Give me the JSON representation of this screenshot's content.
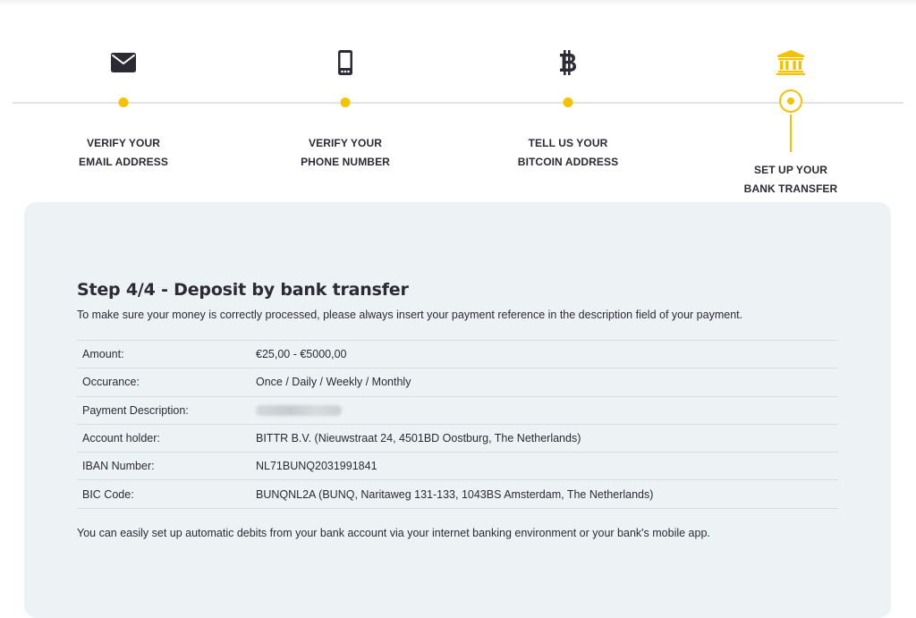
{
  "stepper": {
    "accent_color": "#f5c200",
    "steps": [
      {
        "icon": "envelope-icon",
        "line1": "VERIFY YOUR",
        "line2": "EMAIL ADDRESS",
        "state": "completed"
      },
      {
        "icon": "smartphone-icon",
        "line1": "VERIFY YOUR",
        "line2": "PHONE NUMBER",
        "state": "completed"
      },
      {
        "icon": "bitcoin-icon",
        "line1": "TELL US YOUR",
        "line2": "BITCOIN ADDRESS",
        "state": "completed"
      },
      {
        "icon": "bank-icon",
        "line1": "SET UP YOUR",
        "line2": "BANK TRANSFER",
        "state": "active"
      }
    ]
  },
  "card": {
    "title": "Step 4/4 - Deposit by bank transfer",
    "intro": "To make sure your money is correctly processed, please always insert your payment reference in the description field of your payment.",
    "rows": [
      {
        "label": "Amount:",
        "value": "€25,00 - €5000,00"
      },
      {
        "label": "Occurance:",
        "value": "Once / Daily / Weekly / Monthly"
      },
      {
        "label": "Payment Description:",
        "value": ""
      },
      {
        "label": "Account holder:",
        "value": "BITTR B.V. (Nieuwstraat 24, 4501BD Oostburg, The Netherlands)"
      },
      {
        "label": "IBAN Number:",
        "value": "NL71BUNQ2031991841"
      },
      {
        "label": "BIC Code:",
        "value": "BUNQNL2A (BUNQ, Naritaweg 131-133, 1043BS Amsterdam, The Netherlands)"
      }
    ],
    "footer": "You can easily set up automatic debits from your bank account via your internet banking environment or your bank's mobile app."
  }
}
